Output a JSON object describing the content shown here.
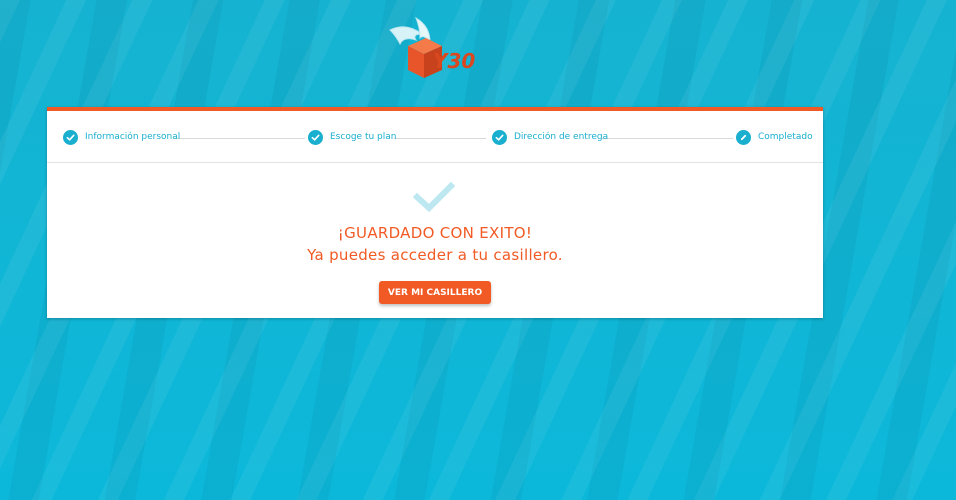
{
  "brand": {
    "logo_text": "Y30"
  },
  "steps": [
    {
      "label": "Información personal",
      "state": "done",
      "icon": "check-icon"
    },
    {
      "label": "Escoge tu plan",
      "state": "done",
      "icon": "check-icon"
    },
    {
      "label": "Dirección de entrega",
      "state": "done",
      "icon": "check-icon"
    },
    {
      "label": "Completado",
      "state": "current",
      "icon": "pencil-icon"
    }
  ],
  "result": {
    "icon": "check-icon",
    "title": "¡GUARDADO CON EXITO!",
    "message": "Ya puedes acceder a tu casillero.",
    "button_label": "VER MI CASILLERO"
  },
  "colors": {
    "accent": "#f15a24",
    "primary": "#1aaecf",
    "background": "#1ab7d4"
  }
}
